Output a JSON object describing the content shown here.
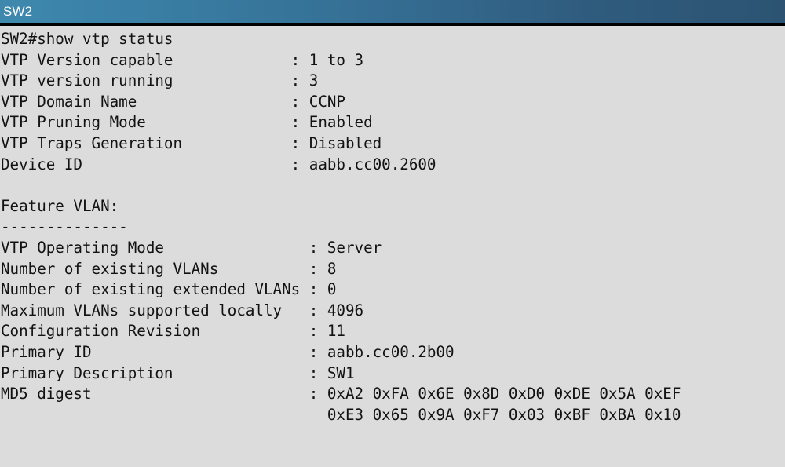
{
  "window": {
    "title": "SW2",
    "titlebar_gradient_from": "#3e88ae",
    "titlebar_gradient_to": "#2c5372",
    "titlebar_text_color": "#ffffff",
    "separator_color": "#000000",
    "terminal_background": "#dcdcdc",
    "terminal_text_color": "#121212"
  },
  "terminal": {
    "prompt": "SW2#",
    "command": "show vtp status",
    "command_line": "SW2#show vtp status",
    "lines": [
      "SW2#show vtp status",
      "VTP Version capable             : 1 to 3",
      "VTP version running             : 3",
      "VTP Domain Name                 : CCNP",
      "VTP Pruning Mode                : Enabled",
      "VTP Traps Generation            : Disabled",
      "Device ID                       : aabb.cc00.2600",
      "",
      "Feature VLAN:",
      "--------------",
      "VTP Operating Mode                : Server",
      "Number of existing VLANs          : 8",
      "Number of existing extended VLANs : 0",
      "Maximum VLANs supported locally   : 4096",
      "Configuration Revision            : 11",
      "Primary ID                        : aabb.cc00.2b00",
      "Primary Description               : SW1",
      "MD5 digest                        : 0xA2 0xFA 0x6E 0x8D 0xD0 0xDE 0x5A 0xEF",
      "                                    0xE3 0x65 0x9A 0xF7 0x03 0xBF 0xBA 0x10"
    ],
    "vtp_status": {
      "vtp_version_capable": "1 to 3",
      "vtp_version_running": "3",
      "vtp_domain_name": "CCNP",
      "vtp_pruning_mode": "Enabled",
      "vtp_traps_generation": "Disabled",
      "device_id": "aabb.cc00.2600"
    },
    "feature_vlan": {
      "heading": "Feature VLAN:",
      "underline": "--------------",
      "vtp_operating_mode": "Server",
      "number_of_existing_vlans": "8",
      "number_of_existing_extended_vlans": "0",
      "maximum_vlans_supported_locally": "4096",
      "configuration_revision": "11",
      "primary_id": "aabb.cc00.2b00",
      "primary_description": "SW1",
      "md5_digest_line_1": "0xA2 0xFA 0x6E 0x8D 0xD0 0xDE 0x5A 0xEF",
      "md5_digest_line_2": "0xE3 0x65 0x9A 0xF7 0x03 0xBF 0xBA 0x10"
    }
  }
}
